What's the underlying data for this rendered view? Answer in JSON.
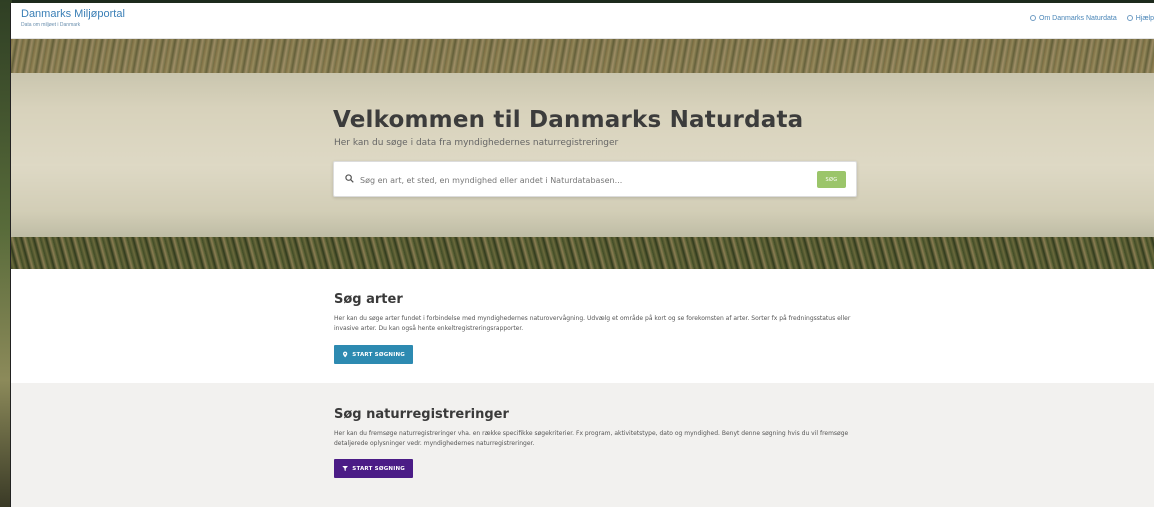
{
  "header": {
    "brand_title": "Danmarks Miljøportal",
    "brand_sub": "Data om miljøet i Danmark",
    "nav": [
      {
        "label": "Om Danmarks Naturdata",
        "icon": "info-icon"
      },
      {
        "label": "Hjælp",
        "icon": "help-icon"
      }
    ]
  },
  "hero": {
    "title": "Velkommen til Danmarks Naturdata",
    "subtitle": "Her kan du søge i data fra myndighedernes naturregistreringer",
    "search_placeholder": "Søg en art, et sted, en myndighed eller andet i Naturdatabasen...",
    "search_button": "SØG"
  },
  "sections": [
    {
      "title": "Søg arter",
      "text": "Her kan du søge arter fundet i forbindelse med myndighedernes naturovervågning. Udvælg et område på kort og se forekomsten af arter. Sorter fx på fredningsstatus eller invasive arter. Du kan også hente enkeltregistreringsrapporter.",
      "button": "START SØGNING",
      "icon": "map-pin-icon",
      "color": "#2d8ab1"
    },
    {
      "title": "Søg naturregistreringer",
      "text": "Her kan du fremsøge naturregistreringer vha. en række specifikke søgekriterier. Fx program, aktivitetstype, dato og myndighed. Benyt denne søgning hvis du vil fremsøge detaljerede oplysninger vedr. myndighedernes naturregistreringer.",
      "button": "START SØGNING",
      "icon": "filter-icon",
      "color": "#4b1c86"
    }
  ],
  "colors": {
    "brand": "#3a7fb6",
    "search_button": "#9bc56a"
  }
}
